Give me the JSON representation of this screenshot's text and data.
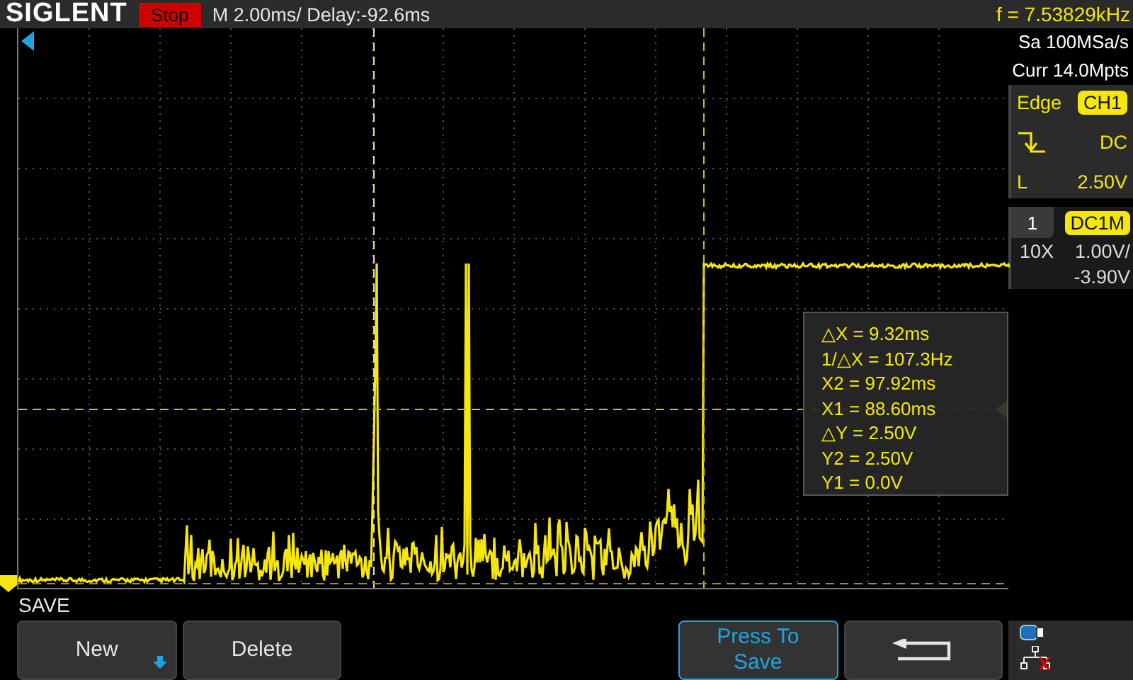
{
  "header": {
    "brand": "SIGLENT",
    "run_state": "Stop",
    "timebase": "M 2.00ms/ Delay:-92.6ms",
    "frequency": "f = 7.53829kHz"
  },
  "acquisition": {
    "sample_rate": "Sa 100MSa/s",
    "memory": "Curr 14.0Mpts"
  },
  "trigger": {
    "type": "Edge",
    "source": "CH1",
    "slope": {
      "kind": "falling"
    },
    "coupling": "DC",
    "level_label": "L",
    "level_value": "2.50V"
  },
  "channel": {
    "number": "1",
    "impedance": "DC1M",
    "probe": "10X",
    "scale": "1.00V/",
    "offset": "-3.90V"
  },
  "cursors": {
    "readings": [
      "△X = 9.32ms",
      "1/△X = 107.3Hz",
      "X2 = 97.92ms",
      "X1 = 88.60ms",
      "△Y = 2.50V",
      "Y2 = 2.50V",
      "Y1 = 0.0V"
    ]
  },
  "menu": {
    "title": "SAVE",
    "buttons": [
      {
        "kind": "text",
        "label": "New",
        "dropdown": true,
        "highlighted": false
      },
      {
        "kind": "text",
        "label": "Delete",
        "dropdown": false,
        "highlighted": false
      },
      {
        "kind": "empty"
      },
      {
        "kind": "empty"
      },
      {
        "kind": "text",
        "label": "Press To Save",
        "dropdown": false,
        "highlighted": true
      },
      {
        "kind": "back"
      }
    ]
  }
}
